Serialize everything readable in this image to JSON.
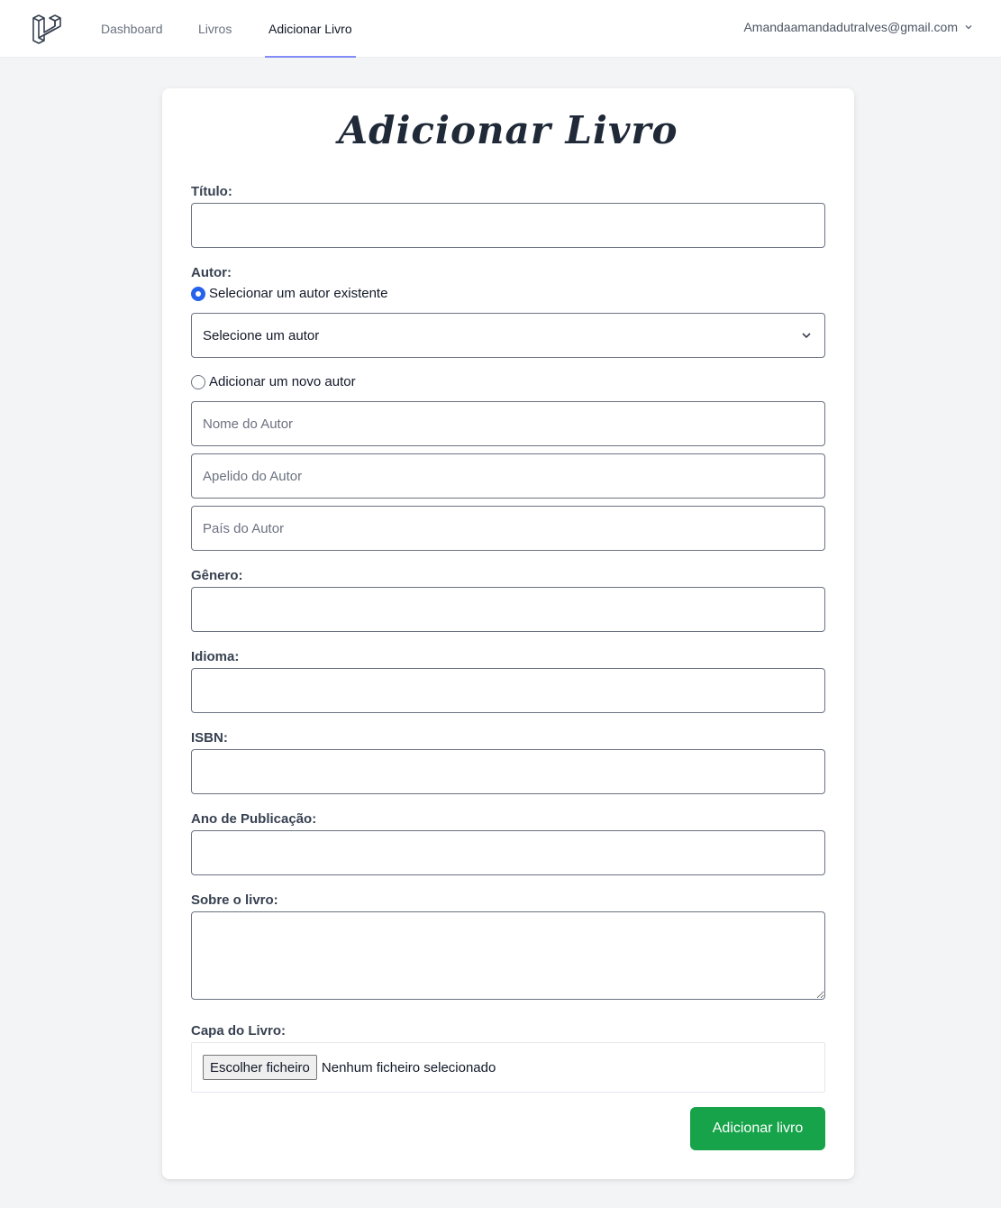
{
  "nav": {
    "logo_icon": "laravel-logo-icon",
    "links": [
      {
        "label": "Dashboard",
        "active": false
      },
      {
        "label": "Livros",
        "active": false
      },
      {
        "label": "Adicionar Livro",
        "active": true
      }
    ],
    "user_email": "Amandaamandadutralves@gmail.com",
    "user_menu_icon": "chevron-down-icon"
  },
  "form": {
    "heading": "Adicionar Livro",
    "titulo": {
      "label": "Título:",
      "value": ""
    },
    "autor": {
      "label": "Autor:",
      "existing_option": "Selecionar um autor existente",
      "existing_selected": true,
      "select_value": "Selecione um autor",
      "new_option": "Adicionar um novo autor",
      "nome_placeholder": "Nome do Autor",
      "apelido_placeholder": "Apelido do Autor",
      "pais_placeholder": "País do Autor"
    },
    "genero": {
      "label": "Gênero:",
      "value": ""
    },
    "idioma": {
      "label": "Idioma:",
      "value": ""
    },
    "isbn": {
      "label": "ISBN:",
      "value": ""
    },
    "ano": {
      "label": "Ano de Publicação:",
      "value": ""
    },
    "sobre": {
      "label": "Sobre o livro:",
      "value": ""
    },
    "capa": {
      "label": "Capa do Livro:",
      "button_label": "Escolher ficheiro",
      "status": "Nenhum ficheiro selecionado"
    },
    "submit_label": "Adicionar livro"
  },
  "colors": {
    "accent_underline": "#818cf8",
    "radio_selected": "#2563eb",
    "submit_button": "#16a34a"
  }
}
